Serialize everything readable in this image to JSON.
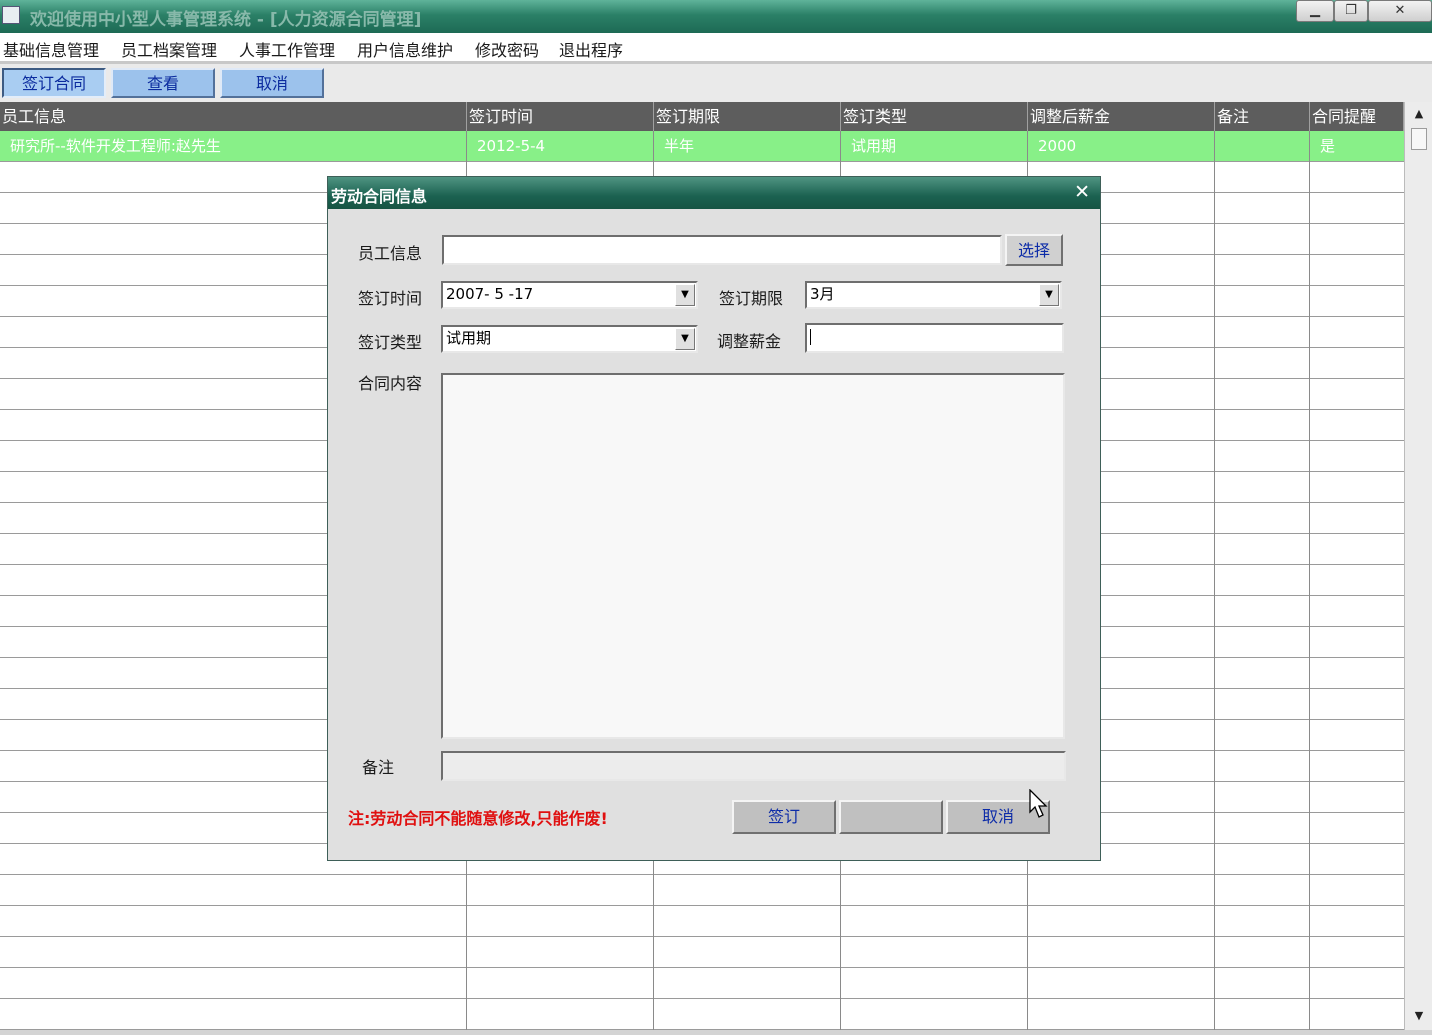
{
  "window": {
    "title": "欢迎使用中小型人事管理系统 - [人力资源合同管理]",
    "controls": [
      "minimize",
      "restore",
      "close"
    ]
  },
  "menu": [
    "基础信息管理",
    "员工档案管理",
    "人事工作管理",
    "用户信息维护",
    "修改密码",
    "退出程序"
  ],
  "toolbar": {
    "sign_label": "签订合同",
    "view_label": "查看",
    "cancel_label": "取消"
  },
  "grid": {
    "columns": [
      "员工信息",
      "签订时间",
      "签订期限",
      "签订类型",
      "调整后薪金",
      "备注",
      "合同提醒"
    ],
    "rows": [
      [
        "研究所--软件开发工程师:赵先生",
        "2012-5-4",
        "半年",
        "试用期",
        "2000",
        "",
        "是"
      ]
    ],
    "selected_row_color": "#88f088"
  },
  "dialog": {
    "title": "劳动合同信息",
    "close_icon": "close-icon",
    "employee_label": "员工信息",
    "employee_value": "",
    "select_label": "选择",
    "sign_date_label": "签订时间",
    "sign_date_value": "2007- 5 -17",
    "term_label": "签订期限",
    "term_value": "3月",
    "type_label": "签订类型",
    "type_value": "试用期",
    "salary_label": "调整薪金",
    "salary_value": "",
    "content_label": "合同内容",
    "content_value": "",
    "remark_label": "备注",
    "remark_value": "",
    "note": "注:劳动合同不能随意修改,只能作废!",
    "sign_button": "签订",
    "blank_button": "",
    "cancel_button": "取消"
  }
}
